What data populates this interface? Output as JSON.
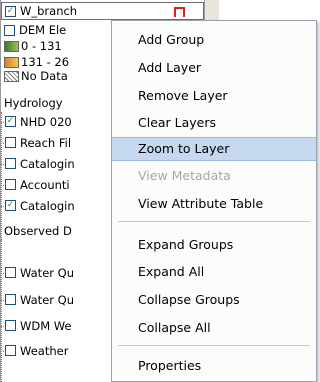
{
  "layers": {
    "top_item": "W_branch",
    "dem_layer": "DEM Ele",
    "legend": [
      {
        "label": "0 - 131",
        "color": "#6aa04a"
      },
      {
        "label": "131 - 26",
        "color": "#e8a23a"
      },
      {
        "label": "No Data",
        "color": "hatch"
      }
    ],
    "groups": [
      {
        "label": "Hydrology",
        "items": [
          {
            "label": "NHD 020",
            "checked": true
          },
          {
            "label": "Reach Fil",
            "checked": false
          },
          {
            "label": "Catalogin",
            "checked": false
          },
          {
            "label": "Accounti",
            "checked": false
          },
          {
            "label": "Catalogin",
            "checked": true
          }
        ]
      },
      {
        "label": "Observed D",
        "items": [
          {
            "label": "Water Qu",
            "checked": false
          },
          {
            "label": "Water Qu",
            "checked": false
          },
          {
            "label": "WDM We",
            "checked": false
          },
          {
            "label": "Weather",
            "checked": false
          }
        ]
      }
    ]
  },
  "context_menu": {
    "items": [
      {
        "label": "Add Group",
        "enabled": true
      },
      {
        "label": "Add Layer",
        "enabled": true
      },
      {
        "label": "Remove Layer",
        "enabled": true
      },
      {
        "label": "Clear Layers",
        "enabled": true
      },
      {
        "label": "Zoom to Layer",
        "enabled": true,
        "highlighted": true
      },
      {
        "label": "View Metadata",
        "enabled": false
      },
      {
        "label": "View Attribute Table",
        "enabled": true
      },
      {
        "label": "Expand Groups",
        "enabled": true
      },
      {
        "label": "Expand All",
        "enabled": true
      },
      {
        "label": "Collapse Groups",
        "enabled": true
      },
      {
        "label": "Collapse All",
        "enabled": true
      },
      {
        "label": "Properties",
        "enabled": true
      }
    ],
    "highlight_color": "#c5d8ef",
    "disabled_color": "#a6a6a6"
  }
}
